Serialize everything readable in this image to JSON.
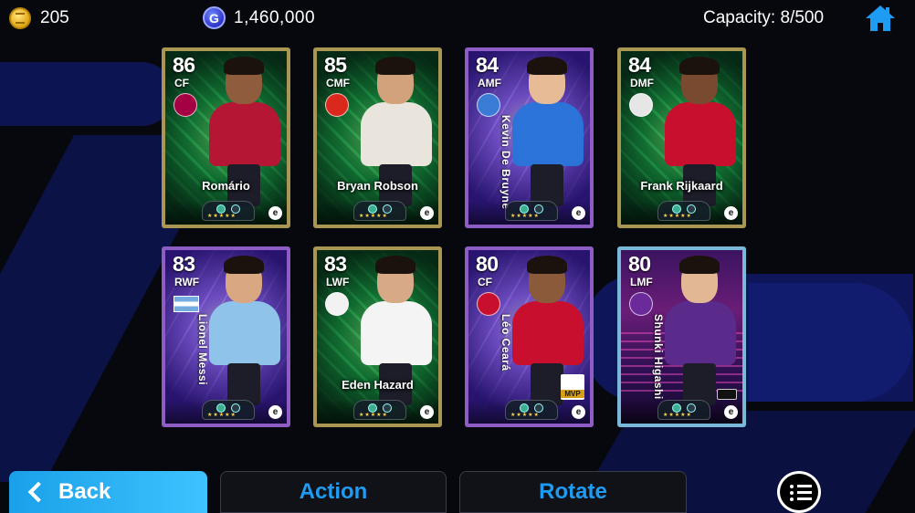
{
  "topbar": {
    "coins": "205",
    "gp": "1,460,000",
    "gp_icon_letter": "G",
    "capacity": "Capacity: 8/500",
    "home_icon": "home-icon"
  },
  "cards": [
    {
      "rating": "86",
      "position": "CF",
      "name": "Romário",
      "name_orientation": "horizontal",
      "frame": "gold",
      "style": "green",
      "badge": "club",
      "badge_color": "#a50044",
      "kit_color": "#b51633",
      "skin": "#8f5d3d"
    },
    {
      "rating": "85",
      "position": "CMF",
      "name": "Bryan Robson",
      "name_orientation": "horizontal",
      "frame": "gold",
      "style": "green",
      "badge": "club",
      "badge_color": "#da291c",
      "kit_color": "#e9e4dc",
      "skin": "#d2a27c"
    },
    {
      "rating": "84",
      "position": "AMF",
      "name": "Kevin De Bruyne",
      "name_orientation": "vertical",
      "frame": "purple",
      "style": "lightning",
      "badge": "club",
      "badge_color": "#3a7bd5",
      "kit_color": "#2b73d9",
      "skin": "#e6bb96"
    },
    {
      "rating": "84",
      "position": "DMF",
      "name": "Frank Rijkaard",
      "name_orientation": "horizontal",
      "frame": "gold",
      "style": "green",
      "badge": "club",
      "badge_color": "#e6e6e6",
      "kit_color": "#c8102e",
      "skin": "#7a4a30"
    },
    {
      "rating": "83",
      "position": "RWF",
      "name": "Lionel Messi",
      "name_orientation": "vertical",
      "frame": "purple",
      "style": "lightning",
      "badge": "flag",
      "badge_color": "#74acdf",
      "kit_color": "#8fc3ea",
      "skin": "#d9a883"
    },
    {
      "rating": "83",
      "position": "LWF",
      "name": "Eden Hazard",
      "name_orientation": "horizontal",
      "frame": "gold",
      "style": "green",
      "badge": "club",
      "badge_color": "#f2f2f2",
      "kit_color": "#f4f4f4",
      "skin": "#d8a987"
    },
    {
      "rating": "80",
      "position": "CF",
      "name": "Léo Ceará",
      "name_orientation": "vertical",
      "frame": "purple",
      "style": "lightning",
      "badge": "club",
      "badge_color": "#c8102e",
      "kit_color": "#c8102e",
      "skin": "#8a5a3a",
      "mvp": "MVP"
    },
    {
      "rating": "80",
      "position": "LMF",
      "name": "Shunki Higashi",
      "name_orientation": "vertical",
      "frame": "blue",
      "style": "neon",
      "badge": "club",
      "badge_color": "#6a2a9a",
      "kit_color": "#5b2b8c",
      "skin": "#e2b894",
      "league_mark": true
    }
  ],
  "bottom": {
    "back_label": "Back",
    "action_label": "Action",
    "rotate_label": "Rotate",
    "menu_icon": "list-menu-icon"
  },
  "colors": {
    "accent_blue": "#1e9bf2",
    "back_button": "#2db3f5",
    "background": "#07080d"
  }
}
